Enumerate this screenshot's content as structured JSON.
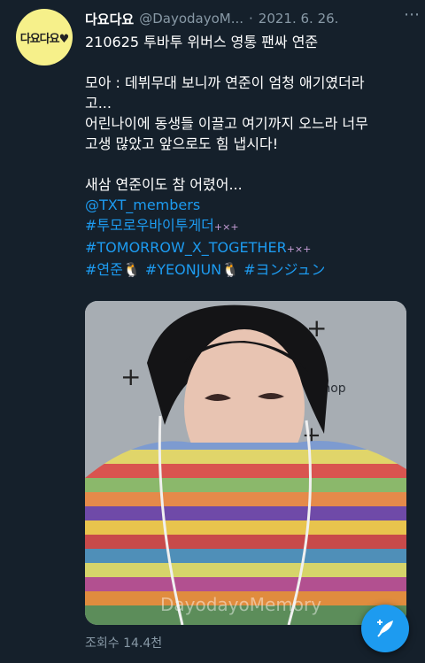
{
  "tweet": {
    "avatar_text": "다요다요♥",
    "name": "다요다요",
    "handle": "@DayodayoM...",
    "date": "2021. 6. 26.",
    "line1": "210625 투바투 위버스 영통 팬싸 연준",
    "line2": "모아 : 데뷔무대 보니까 연준이 엄청 애기였더라",
    "line3": "고...",
    "line4": "어린나이에 동생들 이끌고 여기까지 오느라 너무",
    "line5": "고생 많았고 앞으로도 힘 냅시다!",
    "line6": "새삼 연준이도 참 어렸어...",
    "mention": "@TXT_members",
    "tag1": "#투모로우바이투게더",
    "tag2": "#TOMORROW_X_TOGETHER",
    "tag3": "#연준",
    "tag4": "#YEONJUN",
    "tag5": "#ヨンジュン",
    "deco": "+×+",
    "views": "조회수 14.4천"
  },
  "media": {
    "watermark": "DayodayoMemory",
    "bg_text": "e shop"
  },
  "colors": {
    "background": "#15202b",
    "link": "#1d9bf0",
    "muted": "#8899a6"
  }
}
